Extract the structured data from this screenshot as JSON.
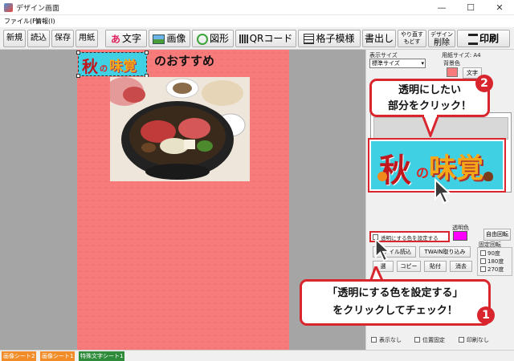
{
  "window": {
    "title": "デザイン画面",
    "minimize": "—",
    "maximize": "☐",
    "close": "✕"
  },
  "menu": [
    "ファイル(F)",
    "情報(I)"
  ],
  "toolbar": {
    "new": "新規",
    "open": "読込",
    "save": "保存",
    "paper": "用紙",
    "text": "文字",
    "image": "画像",
    "shape": "図形",
    "qr": "QRコード",
    "grid": "格子模様",
    "overflow": "書出し",
    "redo_top": "やり直す",
    "redo_bottom": "もどす",
    "design_top": "デザイン",
    "design_bottom": "削除",
    "print": "印刷"
  },
  "canvas": {
    "headline": "のおすすめ",
    "banner": {
      "char1": "秋",
      "char2": "の",
      "char3": "味覚"
    }
  },
  "panel": {
    "display_size_label": "表示サイズ",
    "display_size_value": "標準サイズ",
    "paper_size_label": "用紙サイズ: A4",
    "bg_color_label": "背景色",
    "bg_color_value": "文字",
    "trans_color_label": "透明色",
    "set_transparent": "透明にする色を設定する",
    "rotate_free": "自由回転",
    "load_file": "ファイル読込",
    "twain": "TWAIN取り込み",
    "fixed_rotate": "固定回転",
    "rot_90": "90度",
    "rot_180": "180度",
    "rot_270": "270度",
    "btn_select": "選",
    "btn_copy": "コピー",
    "btn_paste": "貼付",
    "btn_delete": "消去",
    "opt_hide": "表示なし",
    "opt_fixpos": "位置固定",
    "opt_noprint": "印刷なし"
  },
  "tabs": [
    {
      "label": "画像シート2",
      "color": "#f28c28"
    },
    {
      "label": "画像シート1",
      "color": "#f28c28"
    },
    {
      "label": "特殊文字シート1",
      "color": "#2e8b3a"
    }
  ],
  "callouts": {
    "top_line1": "透明にしたい",
    "top_line2": "部分をクリック！",
    "top_badge": "2",
    "bottom_line1": "「透明にする色を設定する」",
    "bottom_line2": "をクリックしてチェック！",
    "bottom_badge": "1"
  },
  "colors": {
    "accent_red": "#d9262e",
    "canvas_pink": "#f77b7b",
    "banner_cyan": "#3fd0e4",
    "trans_magenta": "#ff00ff"
  }
}
